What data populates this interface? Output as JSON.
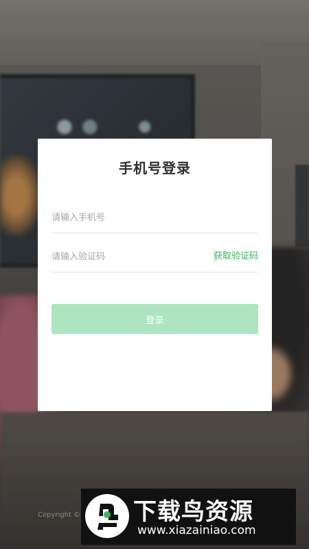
{
  "login": {
    "title": "手机号登录",
    "phone_placeholder": "请输入手机号",
    "code_placeholder": "请输入验证码",
    "get_code_label": "获取验证码",
    "submit_label": "登录"
  },
  "footer": {
    "copyright": "Copyright ©"
  },
  "watermark": {
    "title": "下载鸟资源",
    "url": "www.xiazainiao.com"
  },
  "colors": {
    "accent": "#3bb35f",
    "button_disabled": "#ade5c0"
  }
}
